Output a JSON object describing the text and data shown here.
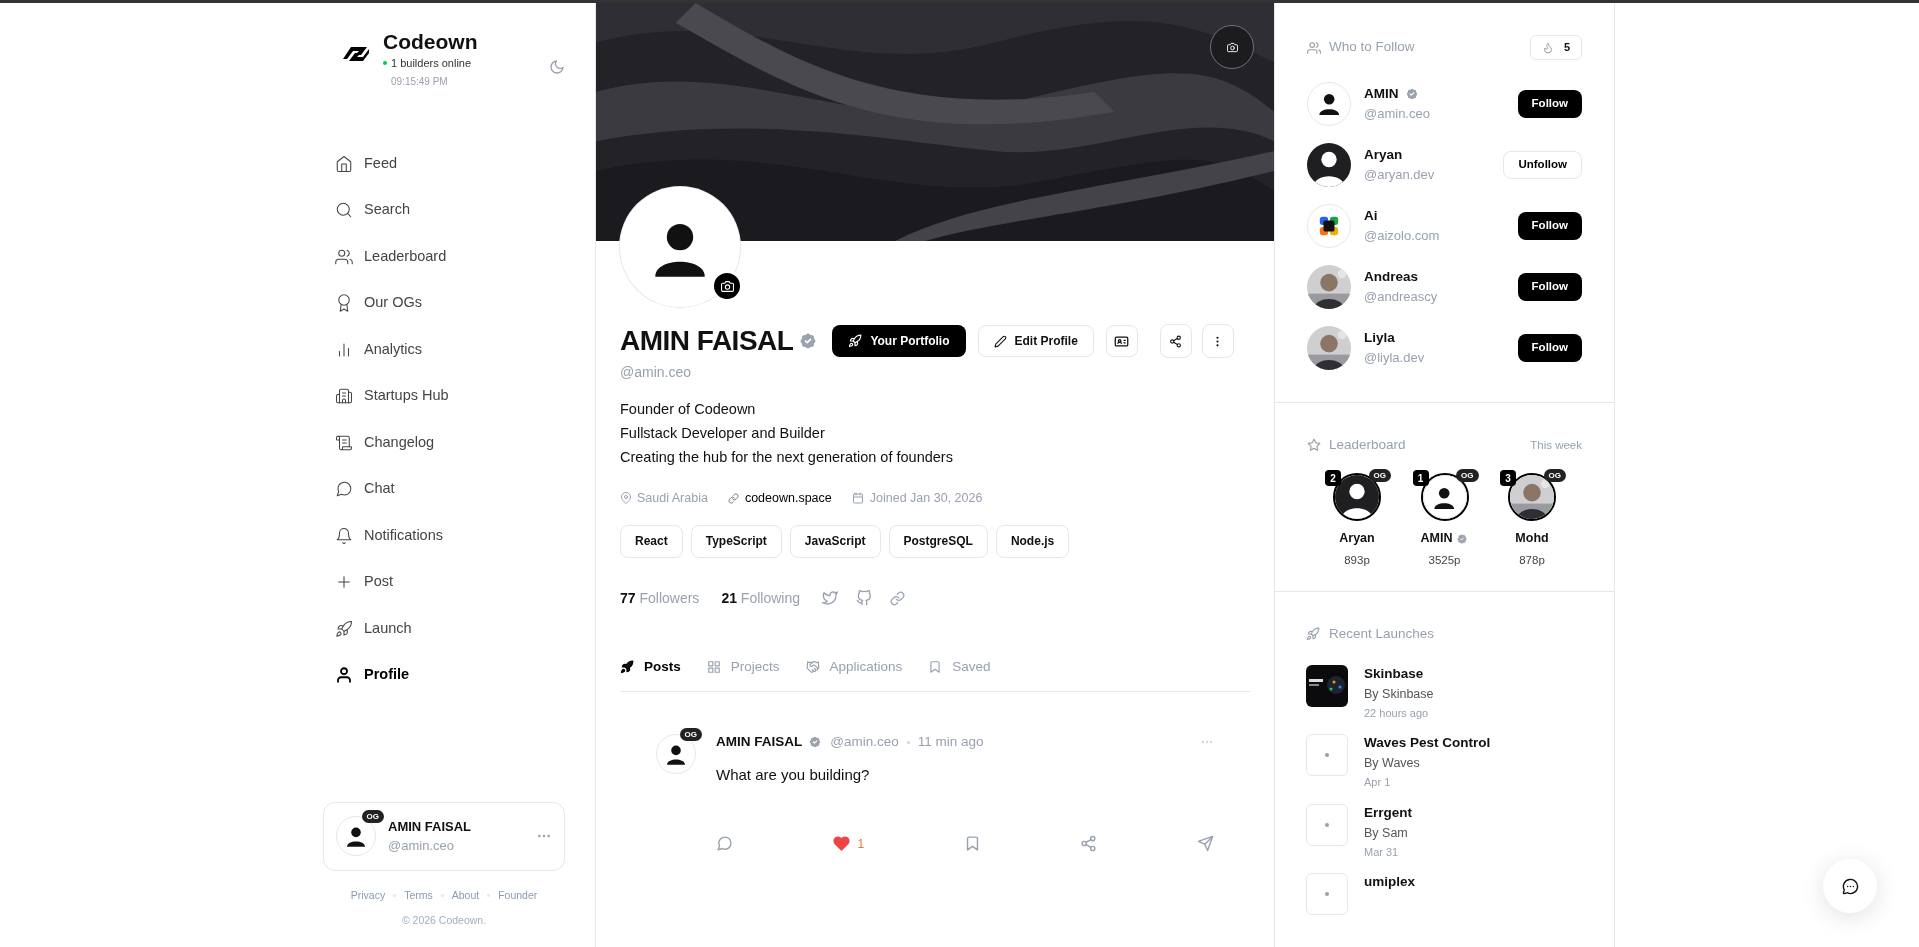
{
  "brand": {
    "name": "Codeown",
    "online": "1 builders online",
    "time": "09:15:49 PM"
  },
  "nav": [
    {
      "label": "Feed",
      "kind": "home",
      "selected": false
    },
    {
      "label": "Search",
      "kind": "search",
      "selected": false
    },
    {
      "label": "Leaderboard",
      "kind": "users",
      "selected": false
    },
    {
      "label": "Our OGs",
      "kind": "award",
      "selected": false
    },
    {
      "label": "Analytics",
      "kind": "chart",
      "selected": false
    },
    {
      "label": "Startups Hub",
      "kind": "building",
      "selected": false
    },
    {
      "label": "Changelog",
      "kind": "scroll",
      "selected": false
    },
    {
      "label": "Chat",
      "kind": "chat",
      "selected": false
    },
    {
      "label": "Notifications",
      "kind": "bell",
      "selected": false
    },
    {
      "label": "Post",
      "kind": "plus",
      "selected": false
    },
    {
      "label": "Launch",
      "kind": "rocket",
      "selected": false
    },
    {
      "label": "Profile",
      "kind": "user",
      "selected": true
    }
  ],
  "user_card": {
    "name": "AMIN FAISAL",
    "handle": "@amin.ceo",
    "badge": "OG"
  },
  "footer_links": [
    "Privacy",
    "Terms",
    "About",
    "Founder"
  ],
  "copyright": "© 2026 Codeown.",
  "profile": {
    "name": "AMIN FAISAL",
    "verified": true,
    "handle": "@amin.ceo",
    "portfolio_button": "Your Portfolio",
    "edit_button": "Edit Profile",
    "bio": [
      "Founder of Codeown",
      "Fullstack Developer and Builder",
      "Creating the hub for the next generation of founders"
    ],
    "location": "Saudi Arabia",
    "website": "codeown.space",
    "joined": "Joined Jan 30, 2026",
    "tags": [
      "React",
      "TypeScript",
      "JavaScript",
      "PostgreSQL",
      "Node.js"
    ],
    "followers_count": "77",
    "followers_label": "Followers",
    "following_count": "21",
    "following_label": "Following"
  },
  "tabs": [
    {
      "label": "Posts",
      "kind": "rocket",
      "selected": true
    },
    {
      "label": "Projects",
      "kind": "grid",
      "selected": false
    },
    {
      "label": "Applications",
      "kind": "handshake",
      "selected": false
    },
    {
      "label": "Saved",
      "kind": "bookmark",
      "selected": false
    }
  ],
  "post": {
    "author": "AMIN FAISAL",
    "verified": true,
    "badge": "OG",
    "handle": "@amin.ceo",
    "time": "11 min ago",
    "text": "What are you building?",
    "likes": "1",
    "liked": true
  },
  "who_to_follow": {
    "title": "Who to Follow",
    "count": "5",
    "users": [
      {
        "name": "AMIN",
        "verified": true,
        "handle": "@amin.ceo",
        "kind": "cartoon",
        "following": false,
        "button": "Follow"
      },
      {
        "name": "Aryan",
        "verified": false,
        "handle": "@aryan.dev",
        "kind": "silhouette",
        "following": true,
        "button": "Unfollow"
      },
      {
        "name": "Ai",
        "verified": false,
        "handle": "@aizolo.com",
        "kind": "logo",
        "following": false,
        "button": "Follow"
      },
      {
        "name": "Andreas",
        "verified": false,
        "handle": "@andreascy",
        "kind": "picture",
        "following": false,
        "button": "Follow"
      },
      {
        "name": "Liyla",
        "verified": false,
        "handle": "@liyla.dev",
        "kind": "picture",
        "following": false,
        "button": "Follow"
      }
    ]
  },
  "leaderboard": {
    "title": "Leaderboard",
    "period": "This week",
    "entries": [
      {
        "rank": "2",
        "badge": "OG",
        "name": "Aryan",
        "verified": false,
        "kind": "silhouette",
        "points": "893p"
      },
      {
        "rank": "1",
        "badge": "OG",
        "name": "AMIN",
        "verified": true,
        "kind": "cartoon",
        "points": "3525p"
      },
      {
        "rank": "3",
        "badge": "OG",
        "name": "Mohd",
        "verified": false,
        "kind": "picture",
        "points": "878p"
      }
    ]
  },
  "launches": {
    "title": "Recent Launches",
    "items": [
      {
        "name": "Skinbase",
        "by": "By Skinbase",
        "time": "22 hours ago",
        "kind": "picture"
      },
      {
        "name": "Waves Pest Control",
        "by": "By Waves",
        "time": "Apr 1",
        "kind": "placeholder"
      },
      {
        "name": "Errgent",
        "by": "By Sam",
        "time": "Mar 31",
        "kind": "placeholder"
      },
      {
        "name": "umiplex",
        "kind": "placeholder"
      }
    ]
  }
}
